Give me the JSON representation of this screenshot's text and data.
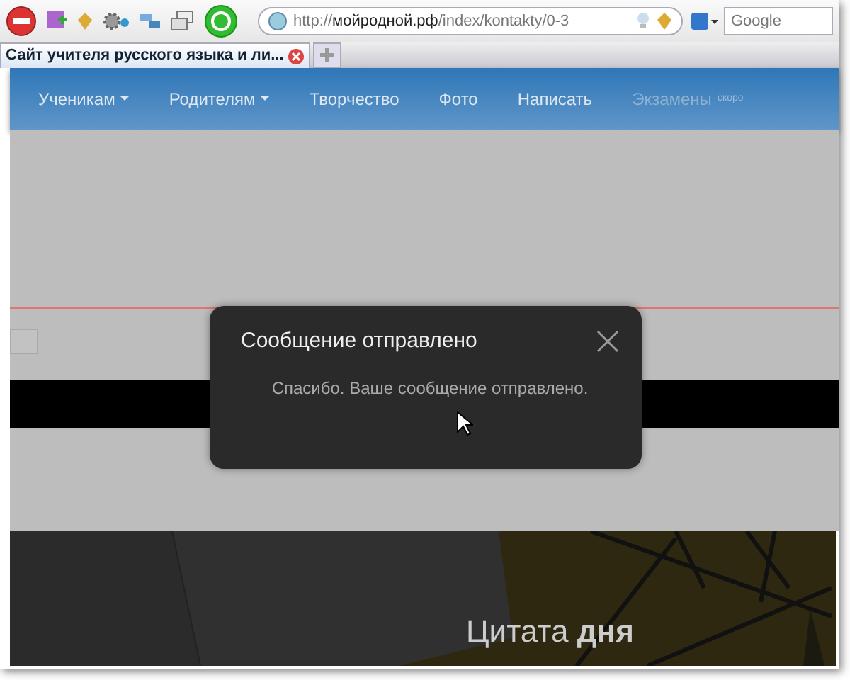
{
  "browser": {
    "address": {
      "host": "мойродной.рф",
      "scheme": "http://",
      "path": "/index/kontakty/0-3"
    },
    "search": {
      "placeholder": "Google"
    },
    "tabs": [
      {
        "label": "Сайт учителя русского языка и ли...",
        "selected": true
      }
    ]
  },
  "nav": {
    "items": [
      {
        "label": "Ученикам",
        "dropdown": true,
        "disabled": false
      },
      {
        "label": "Родителям",
        "dropdown": true,
        "disabled": false
      },
      {
        "label": "Творчество",
        "dropdown": false,
        "disabled": false
      },
      {
        "label": "Фото",
        "dropdown": false,
        "disabled": false
      },
      {
        "label": "Написать",
        "dropdown": false,
        "disabled": false
      },
      {
        "label": "Экзамены",
        "dropdown": false,
        "disabled": true,
        "note": "скоро"
      }
    ]
  },
  "modal": {
    "title": "Сообщение отправлено",
    "body": "Спасибо. Ваше сообщение отправлено."
  },
  "hero": {
    "kind": "picture",
    "title": "Цитата **дня**"
  }
}
